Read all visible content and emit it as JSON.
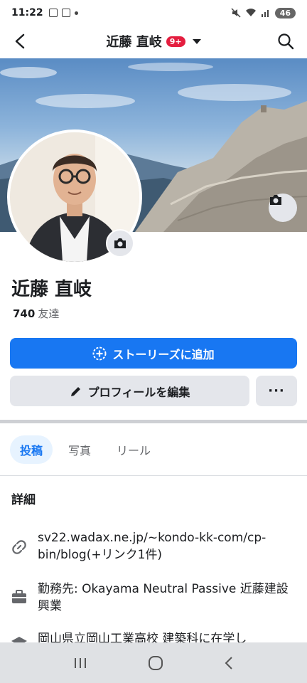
{
  "status_bar": {
    "time": "11:22",
    "battery": "46"
  },
  "header": {
    "title": "近藤 直岐",
    "notification_badge": "9+"
  },
  "profile": {
    "name": "近藤 直岐",
    "friend_count": "740",
    "friend_label": "友達"
  },
  "actions": {
    "add_story_label": "ストーリーズに追加",
    "edit_profile_label": "プロフィールを編集",
    "more_label": "···"
  },
  "tabs": [
    {
      "label": "投稿",
      "active": true
    },
    {
      "label": "写真",
      "active": false
    },
    {
      "label": "リール",
      "active": false
    }
  ],
  "details": {
    "title": "詳細",
    "items": [
      {
        "icon": "link-icon",
        "text": "sv22.wadax.ne.jp/~kondo-kk-com/cp-bin/blog(+リンク1件)"
      },
      {
        "icon": "briefcase-icon",
        "text": "勤務先: Okayama Neutral Passive 近藤建設興業"
      },
      {
        "icon": "graduation-icon",
        "text": "岡山県立岡山工業高校 建築科に在学し"
      }
    ]
  },
  "colors": {
    "primary": "#1877f2",
    "badge": "#e41e3f",
    "secondary_button": "#e4e6eb",
    "tab_active_bg": "#e7f3ff"
  }
}
